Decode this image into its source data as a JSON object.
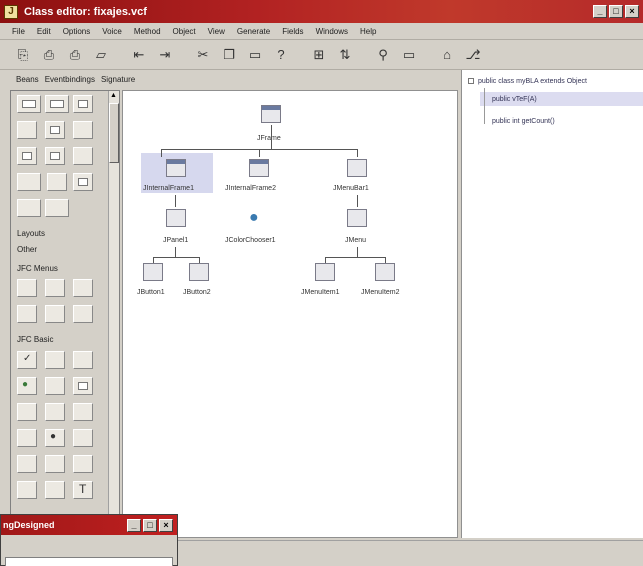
{
  "window": {
    "title": "Class editor: fixajes.vcf",
    "app_icon": "J"
  },
  "menubar": {
    "items": [
      "File",
      "Edit",
      "Options",
      "Voice",
      "Method",
      "Object",
      "View",
      "Generate",
      "Fields",
      "Windows",
      "Help"
    ]
  },
  "toolbar": {
    "icons": [
      "new-icon",
      "save-icon",
      "save-as-icon",
      "open-folder-icon",
      "undo-icon",
      "redo-icon",
      "cut-icon",
      "copy-icon",
      "paste-icon",
      "help-icon",
      "run-icon",
      "debug-icon",
      "search-icon",
      "window-icon",
      "tree-icon",
      "properties-icon"
    ]
  },
  "palette_tabs": {
    "items": [
      "Beans",
      "Eventbindings",
      "Signature"
    ]
  },
  "palette": {
    "sections": {
      "layouts": "Layouts",
      "other": "Other",
      "jfc_menus": "JFC Menus",
      "jfc_basic": "JFC Basic"
    }
  },
  "canvas": {
    "nodes": {
      "root": "JFrame",
      "internal1": "JInternalFrame1",
      "internal2": "JInternalFrame2",
      "menubar": "JMenuBar1",
      "panel": "JPanel1",
      "colorchooser": "JColorChooser1",
      "menu": "JMenu",
      "button1": "JButton1",
      "button2": "JButton2",
      "menuitem1": "JMenuItem1",
      "menuitem2": "JMenuItem2"
    }
  },
  "tree": {
    "items": [
      "public class myBLA extends Object",
      "public vTeF(A)",
      "public int getCount()"
    ]
  },
  "subwindow": {
    "title": "ngDesigned"
  },
  "colors": {
    "titlebar": "#b22222",
    "selection": "#d6d8ee"
  }
}
